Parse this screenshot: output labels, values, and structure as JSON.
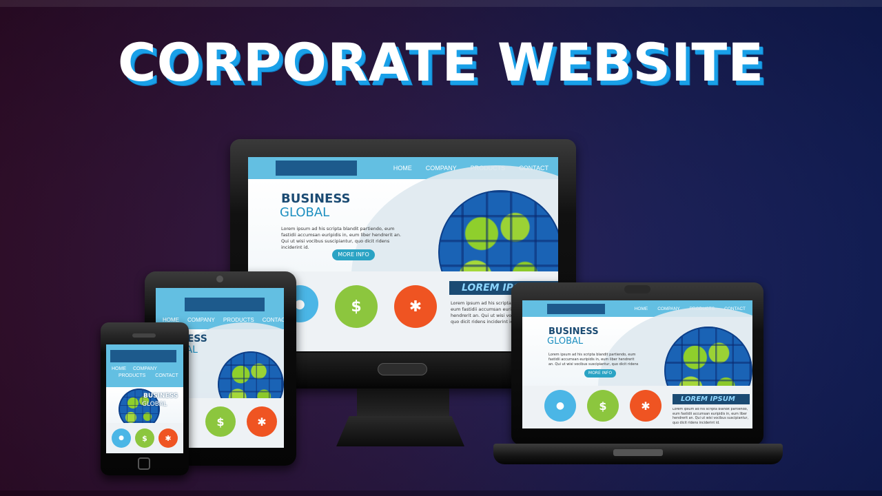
{
  "headline": "CORPORATE WEBSITE",
  "colors": {
    "accent": "#19a0e8",
    "nav_bar": "#63bfe2",
    "logo_block": "#1d5a8c",
    "title_dark": "#1b4b73",
    "title_light": "#1d8fc0",
    "button": "#2aa3c4",
    "icon_blue": "#4bb6e6",
    "icon_green": "#8cc63e",
    "icon_red": "#ef5422"
  },
  "site": {
    "nav": [
      "HOME",
      "COMPANY",
      "PRODUCTS",
      "CONTACT"
    ],
    "hero_title_1": "BUSINESS",
    "hero_title_2": "GLOBAL",
    "hero_text": "Lorem ipsum ad his scripta blandit partiendo, eum fastidii accumsan euripidis in, eum liber hendrerit an. Qui ut wisi vocibus suscipiantur, quo dicit ridens inciderint id.",
    "button": "MORE INFO",
    "banner_monitor": "LOREM IPSU",
    "banner_laptop": "LOREM IPSUM",
    "lower_text": "Lorem ipsum ad his scripta blandit partiendo, eum fastidii accumsan euripidis in, eum liber hendrerit an. Qui ut wisi vocibus suscipiantur, quo dicit ridens inciderint id.",
    "icons": [
      "piggy-bank-icon",
      "money-bag-icon",
      "lightbulb-icon"
    ],
    "dollar_symbol": "$"
  },
  "tablet": {
    "nav": [
      "HOME",
      "COMPANY",
      "PRODUCTS",
      "CONTACT"
    ],
    "hero_title_1": "NESS",
    "hero_title_2": "BAL"
  },
  "phone": {
    "nav_row1": [
      "HOME",
      "COMPANY"
    ],
    "nav_row2": [
      "PRODUCTS",
      "CONTACT"
    ]
  }
}
